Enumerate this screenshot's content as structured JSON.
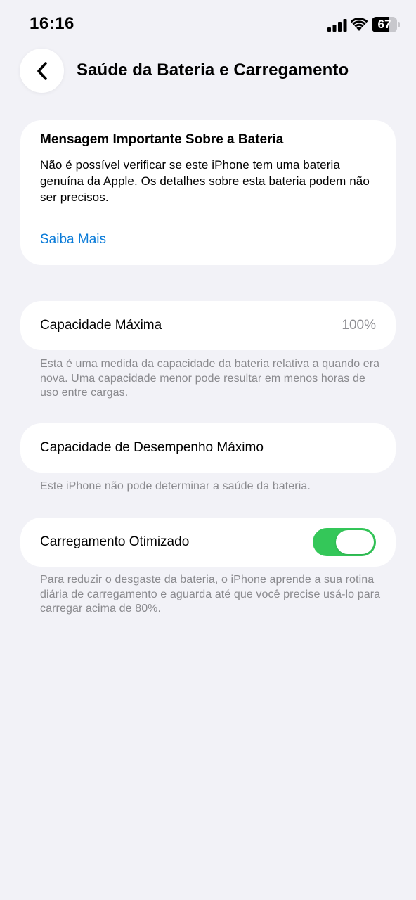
{
  "status_bar": {
    "time": "16:16",
    "battery_level": "67",
    "battery_fraction": 0.67,
    "icons": [
      "cellular-signal-icon",
      "wifi-icon",
      "battery-icon"
    ]
  },
  "header": {
    "back_icon": "chevron-left-icon",
    "title": "Saúde da Bateria e Carregamento"
  },
  "important_message": {
    "title": "Mensagem Importante Sobre a Bateria",
    "body": "Não é possível verificar se este iPhone tem uma bateria genuína da Apple. Os detalhes sobre esta bateria podem não ser precisos.",
    "link": "Saiba Mais"
  },
  "max_capacity": {
    "label": "Capacidade Máxima",
    "value": "100%",
    "footnote": "Esta é uma medida da capacidade da bateria relativa a quando era nova. Uma capacidade menor pode resultar em menos horas de uso entre cargas."
  },
  "peak_performance": {
    "label": "Capacidade de Desempenho Máximo",
    "footnote": "Este iPhone não pode determinar a saúde da bateria."
  },
  "optimized_charging": {
    "label": "Carregamento Otimizado",
    "enabled": true,
    "footnote": "Para reduzir o desgaste da bateria, o iPhone aprende a sua rotina diária de carregamento e aguarda até que você precise usá-lo para carregar acima de 80%."
  },
  "colors": {
    "background": "#f2f2f7",
    "card": "#ffffff",
    "link": "#0a7bd8",
    "toggle_on": "#34c759",
    "secondary_text": "#8a8a8e"
  }
}
